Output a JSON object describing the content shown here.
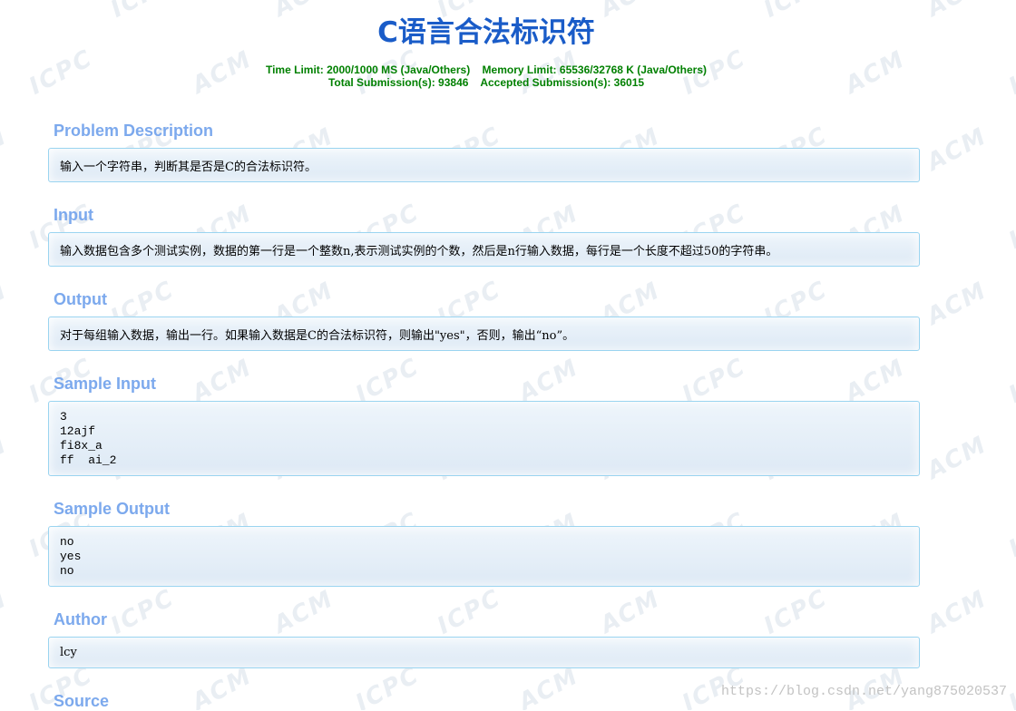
{
  "problem": {
    "title": "C语言合法标识符",
    "limits_line1_time": "Time Limit: 2000/1000 MS (Java/Others)",
    "limits_line1_memory": "Memory Limit: 65536/32768 K (Java/Others)",
    "limits_line2_total": "Total Submission(s): 93846",
    "limits_line2_accepted": "Accepted Submission(s): 36015"
  },
  "sections": {
    "description": {
      "heading": "Problem Description",
      "content": "输入一个字符串，判断其是否是C的合法标识符。"
    },
    "input": {
      "heading": "Input",
      "content": "输入数据包含多个测试实例，数据的第一行是一个整数n,表示测试实例的个数，然后是n行输入数据，每行是一个长度不超过50的字符串。"
    },
    "output": {
      "heading": "Output",
      "content": "对于每组输入数据，输出一行。如果输入数据是C的合法标识符，则输出\"yes\"，否则，输出“no”。"
    },
    "sample_input": {
      "heading": "Sample Input",
      "content": "3\n12ajf\nfi8x_a\nff  ai_2"
    },
    "sample_output": {
      "heading": "Sample Output",
      "content": "no\nyes\nno"
    },
    "author": {
      "heading": "Author",
      "content": "lcy"
    },
    "source": {
      "heading": "Source"
    }
  },
  "watermark": {
    "text_acm": "ACM",
    "text_icpc": "ICPC"
  },
  "footer": {
    "url": "https://blog.csdn.net/yang875020537"
  },
  "colors": {
    "title": "#1a5cc8",
    "limits": "#008000",
    "section_heading": "#7ca9ed",
    "panel_border": "#9ad4f0"
  }
}
